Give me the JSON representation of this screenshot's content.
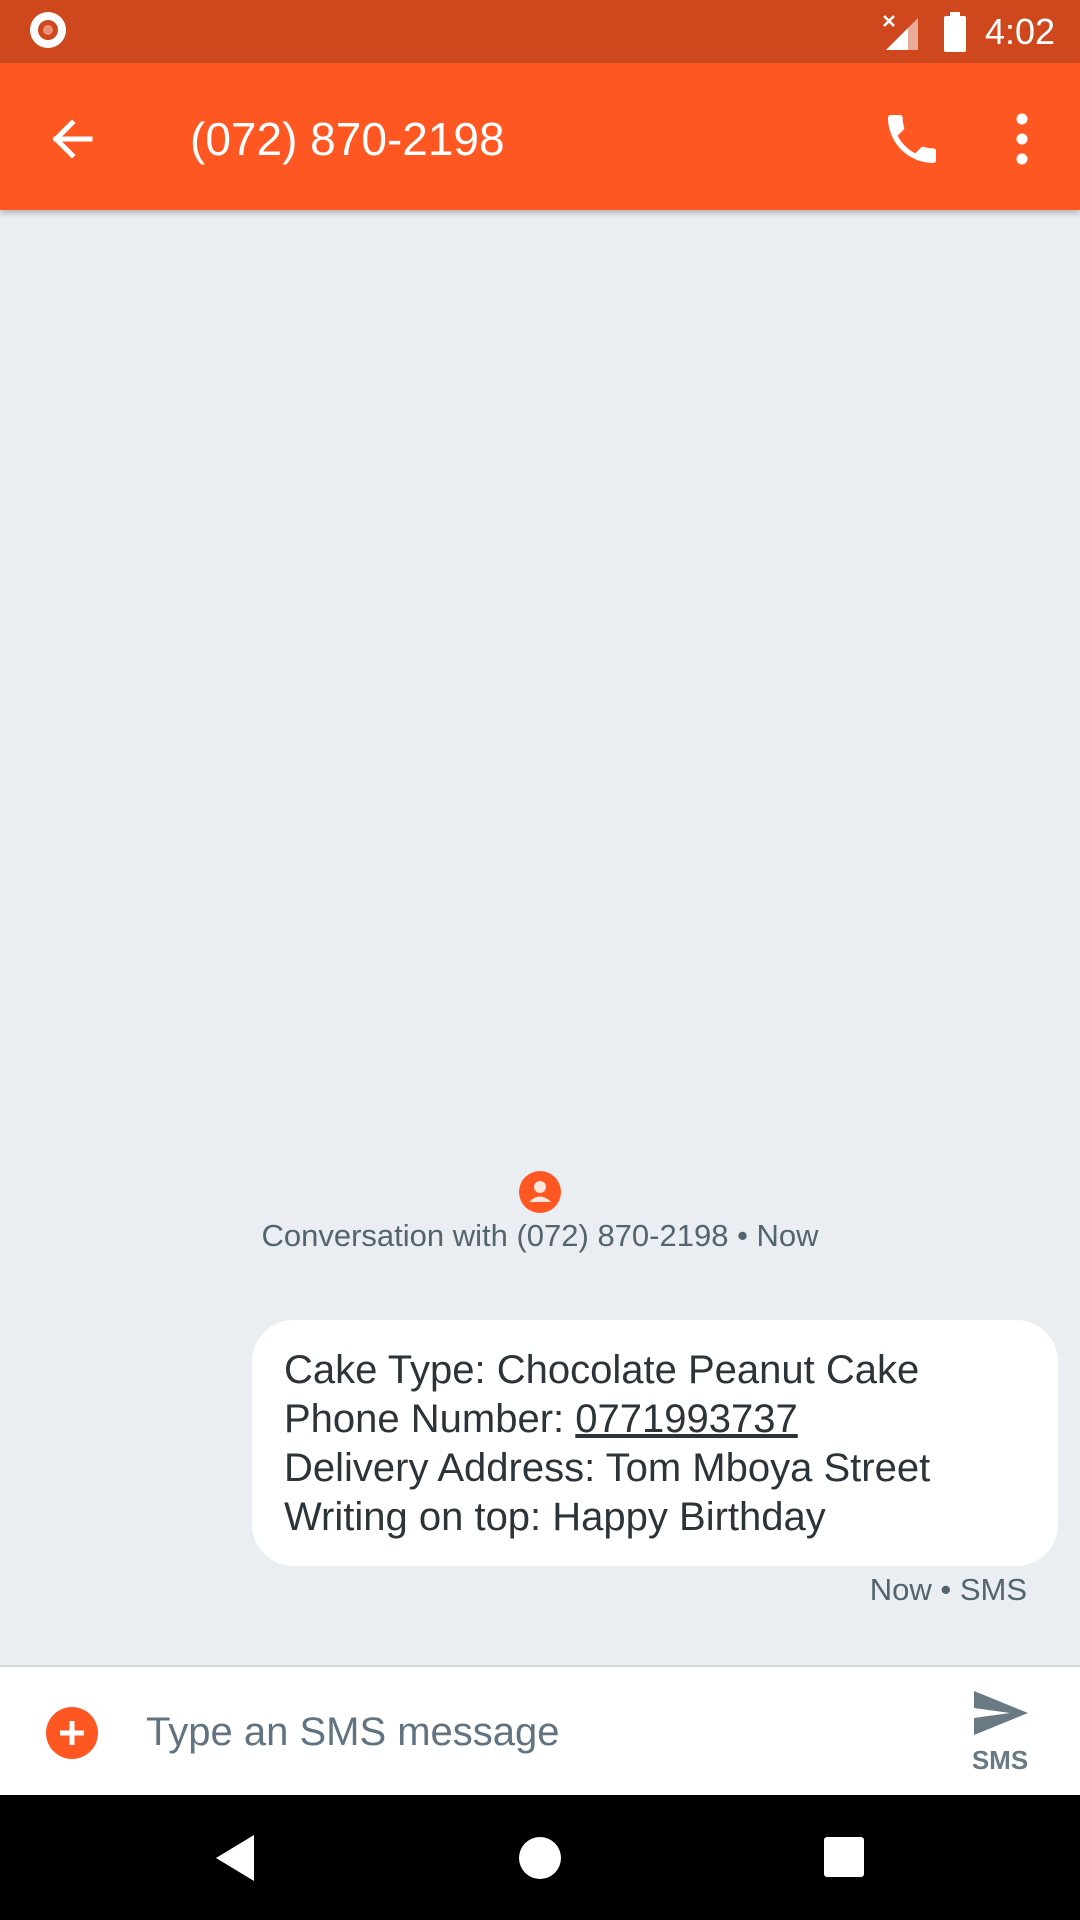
{
  "status_bar": {
    "time": "4:02",
    "icons": [
      "record-icon",
      "signal-icon",
      "battery-icon"
    ]
  },
  "app_bar": {
    "title": "(072) 870-2198",
    "icons": [
      "back-arrow-icon",
      "phone-icon",
      "more-vert-icon"
    ]
  },
  "conversation": {
    "header": "Conversation with (072) 870-2198 • Now",
    "messages": [
      {
        "lines": {
          "l1": "Cake Type: Chocolate Peanut Cake",
          "l2_label": "Phone Number: ",
          "l2_link": "0771993737",
          "l3": "Delivery Address: Tom Mboya Street",
          "l4": "Writing on top: Happy Birthday"
        },
        "meta": "Now • SMS"
      }
    ]
  },
  "compose": {
    "placeholder": "Type an SMS message",
    "value": "",
    "send_label": "SMS"
  },
  "nav": {
    "icons": [
      "nav-back-icon",
      "nav-home-icon",
      "nav-recents-icon"
    ]
  },
  "colors": {
    "status_bar": "#cf481d",
    "accent": "#ff5722",
    "background": "#eaeef2",
    "bubble": "#ffffff"
  }
}
